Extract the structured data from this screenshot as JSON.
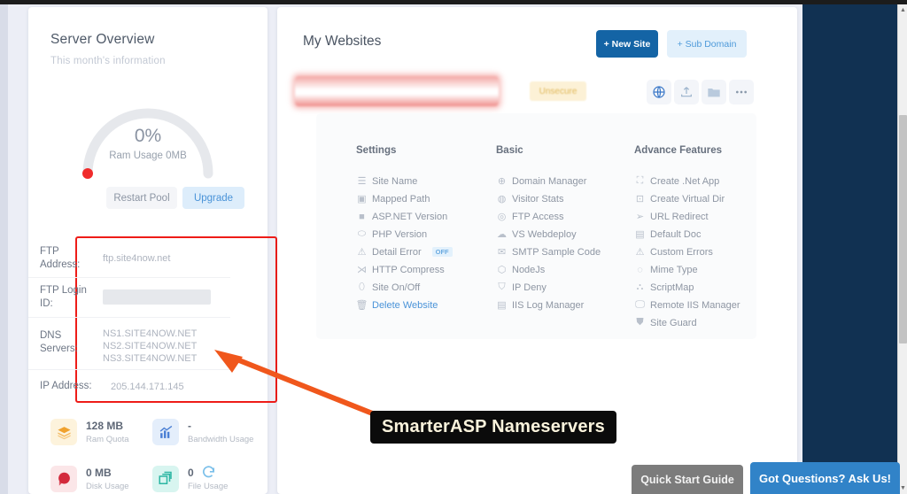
{
  "left_panel": {
    "title": "Server Overview",
    "subtitle": "This month's information",
    "gauge": {
      "percent": "0%",
      "label": "Ram Usage 0MB"
    },
    "buttons": {
      "restart": "Restart  Pool",
      "upgrade": "Upgrade"
    },
    "info_rows": [
      {
        "label": "FTP Address:",
        "value": "ftp.site4now.net"
      },
      {
        "label": "FTP Login ID:",
        "value": ""
      },
      {
        "label": "DNS Servers:",
        "value": "NS1.SITE4NOW.NET\nNS2.SITE4NOW.NET\nNS3.SITE4NOW.NET"
      },
      {
        "label": "IP Address:",
        "value": "205.144.171.145"
      }
    ],
    "dns_servers": [
      "NS1.SITE4NOW.NET",
      "NS2.SITE4NOW.NET",
      "NS3.SITE4NOW.NET"
    ],
    "stats": [
      {
        "value": "128 MB",
        "caption": "Ram Quota",
        "icon": "layers-icon"
      },
      {
        "value": "-",
        "caption": "Bandwidth Usage",
        "icon": "chart-icon"
      },
      {
        "value": "0 MB",
        "caption": "Disk Usage",
        "icon": "pie-icon"
      },
      {
        "value": "0",
        "caption": "File Usage",
        "icon": "files-icon"
      }
    ]
  },
  "right_panel": {
    "title": "My Websites",
    "new_site_label": "+ New Site",
    "sub_domain_label": "+ Sub Domain",
    "site_row": {
      "domain_redacted": "",
      "status_badge": "Unsecure",
      "icons": [
        "globe-icon",
        "upload-icon",
        "folder-icon",
        "ellipsis-icon"
      ]
    },
    "columns": [
      {
        "heading": "Settings",
        "items": [
          {
            "label": "Site Name",
            "icon": "list-icon"
          },
          {
            "label": "Mapped Path",
            "icon": "path-icon"
          },
          {
            "label": "ASP.NET Version",
            "icon": "square-icon"
          },
          {
            "label": "PHP Version",
            "icon": "php-icon"
          },
          {
            "label": "Detail Error",
            "icon": "warning-icon",
            "badge": "OFF"
          },
          {
            "label": "HTTP Compress",
            "icon": "compress-icon"
          },
          {
            "label": "Site On/Off",
            "icon": "toggle-icon"
          },
          {
            "label": "Delete Website",
            "icon": "trash-icon",
            "link": true
          }
        ]
      },
      {
        "heading": "Basic",
        "items": [
          {
            "label": "Domain Manager",
            "icon": "globe-icon"
          },
          {
            "label": "Visitor Stats",
            "icon": "stats-icon"
          },
          {
            "label": "FTP Access",
            "icon": "ftp-icon"
          },
          {
            "label": "VS Webdeploy",
            "icon": "cloud-icon"
          },
          {
            "label": "SMTP Sample Code",
            "icon": "mail-icon"
          },
          {
            "label": "NodeJs",
            "icon": "node-icon"
          },
          {
            "label": "IP Deny",
            "icon": "shield-icon"
          },
          {
            "label": "IIS Log Manager",
            "icon": "log-icon"
          }
        ]
      },
      {
        "heading": "Advance Features",
        "items": [
          {
            "label": "Create .Net App",
            "icon": "app-icon"
          },
          {
            "label": "Create Virtual Dir",
            "icon": "dir-icon"
          },
          {
            "label": "URL Redirect",
            "icon": "send-icon"
          },
          {
            "label": "Default Doc",
            "icon": "doc-icon"
          },
          {
            "label": "Custom Errors",
            "icon": "warning-icon"
          },
          {
            "label": "Mime Type",
            "icon": "mime-icon"
          },
          {
            "label": "ScriptMap",
            "icon": "scriptmap-icon"
          },
          {
            "label": "Remote IIS Manager",
            "icon": "remote-icon"
          },
          {
            "label": "Site Guard",
            "icon": "guard-icon"
          }
        ]
      }
    ]
  },
  "annotation": {
    "callout_text": "SmarterASP Nameservers",
    "arrow_color": "#f0571c",
    "highlight_color": "#ee1c18"
  },
  "bottom_bar": {
    "quick_start": "Quick Start Guide",
    "ask_us": "Got Questions? Ask Us!"
  },
  "colors": {
    "accent_blue": "#1464a5",
    "navy_panel": "#113152",
    "badge_amber": "#e0b95c"
  }
}
